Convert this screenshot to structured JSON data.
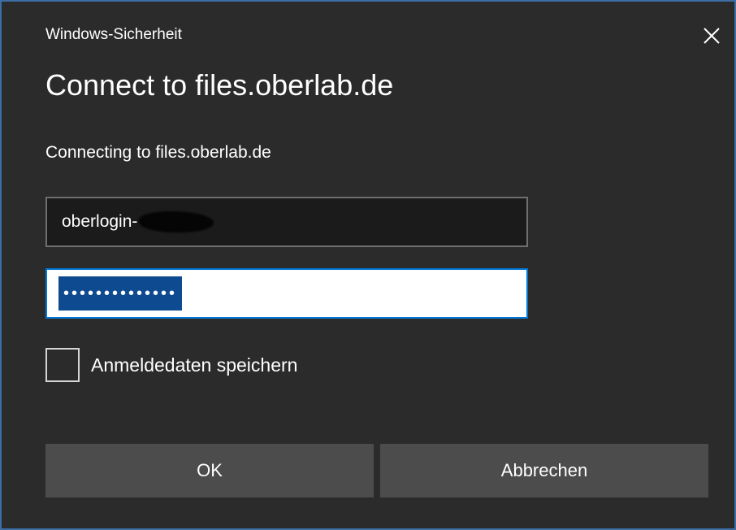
{
  "window": {
    "title": "Windows-Sicherheit",
    "close_icon": "close-icon",
    "accent": "#0078d7"
  },
  "dialog": {
    "heading": "Connect to files.oberlab.de",
    "subtext": "Connecting to files.oberlab.de"
  },
  "fields": {
    "username_value": "oberlogin-",
    "password_mask": "••••••••••••••"
  },
  "checkbox": {
    "label": "Anmeldedaten speichern",
    "checked": false
  },
  "buttons": {
    "ok_label": "OK",
    "cancel_label": "Abbrechen"
  }
}
